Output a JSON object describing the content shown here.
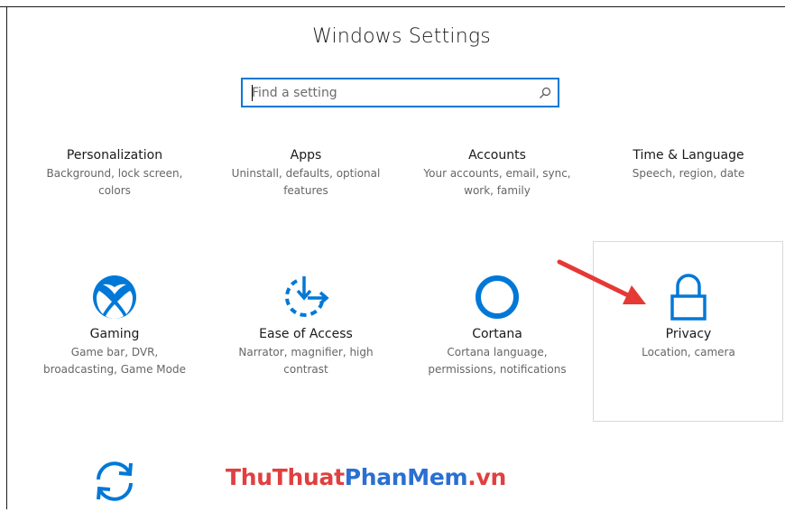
{
  "window": {
    "title": "Windows Settings"
  },
  "search": {
    "placeholder": "Find a setting",
    "value": ""
  },
  "tiles_row1": [
    {
      "name": "Personalization",
      "desc_line1": "Background, lock screen,",
      "desc_line2": "colors"
    },
    {
      "name": "Apps",
      "desc_line1": "Uninstall, defaults, optional",
      "desc_line2": "features"
    },
    {
      "name": "Accounts",
      "desc_line1": "Your accounts, email, sync,",
      "desc_line2": "work, family"
    },
    {
      "name": "Time & Language",
      "desc_line1": "Speech, region, date",
      "desc_line2": ""
    }
  ],
  "tiles_row2": [
    {
      "name": "Gaming",
      "icon": "xbox-icon",
      "desc_line1": "Game bar, DVR,",
      "desc_line2": "broadcasting, Game Mode"
    },
    {
      "name": "Ease of Access",
      "icon": "ease-of-access-icon",
      "desc_line1": "Narrator, magnifier, high",
      "desc_line2": "contrast"
    },
    {
      "name": "Cortana",
      "icon": "cortana-icon",
      "desc_line1": "Cortana language,",
      "desc_line2": "permissions, notifications"
    },
    {
      "name": "Privacy",
      "icon": "lock-icon",
      "desc_line1": "Location, camera",
      "desc_line2": ""
    }
  ],
  "tiles_row3": [
    {
      "icon": "update-sync-icon"
    }
  ],
  "watermark": {
    "part1": "ThuThuat",
    "part2": "PhanMem",
    "part3": ".vn"
  },
  "colors": {
    "accent": "#0078d7",
    "arrow": "#e53935",
    "watermark_red": "#e04040",
    "watermark_blue": "#2a6fd1"
  }
}
